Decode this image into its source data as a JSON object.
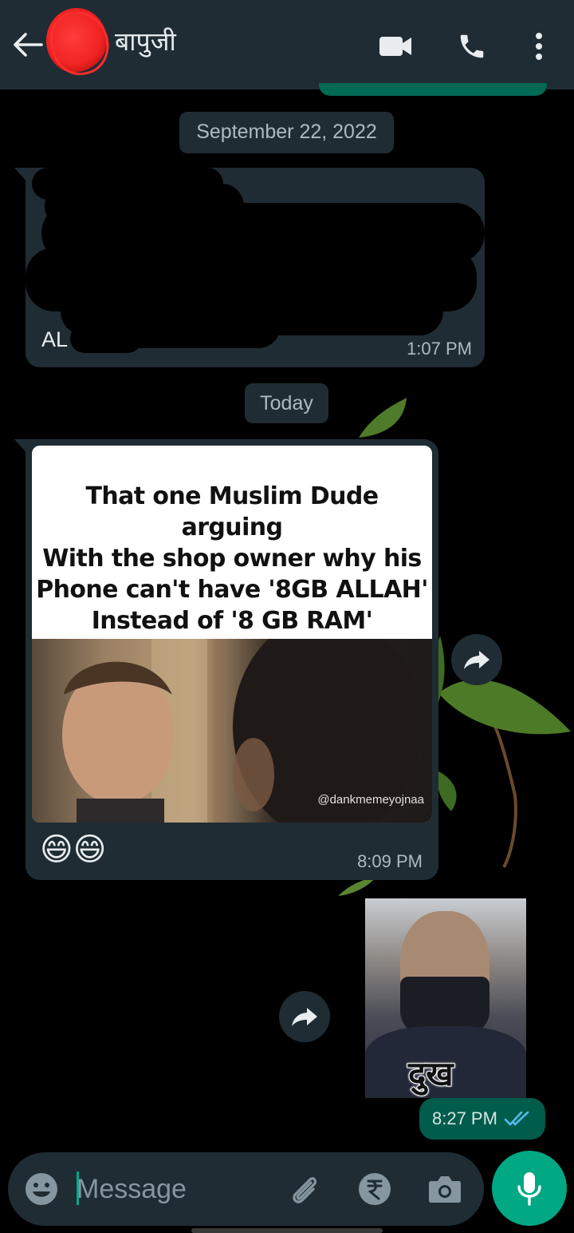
{
  "header": {
    "contact_name": "बापुजी",
    "icons": [
      "back-arrow-icon",
      "avatar",
      "video-call-icon",
      "phone-icon",
      "more-vert-icon"
    ]
  },
  "chat": {
    "date_separator_1": "September 22, 2022",
    "message_1": {
      "visible_text": "AL",
      "time": "1:07 PM",
      "redacted": true
    },
    "date_separator_2": "Today",
    "message_2": {
      "meme_caption_lines": [
        "That one Muslim Dude arguing",
        "With the shop owner why his",
        "Phone can't have '8GB ALLAH'",
        "Instead of '8 GB RAM'"
      ],
      "watermark": "@dankmemeyojnaa",
      "emoji_text": "😄😄",
      "time": "8:09 PM"
    },
    "message_3": {
      "sticker_text": "दुख",
      "time": "8:27 PM",
      "status_icon": "double-check-read-icon"
    }
  },
  "input": {
    "placeholder": "Message",
    "icons": [
      "emoji-icon",
      "attach-icon",
      "rupee-icon",
      "camera-icon",
      "mic-icon"
    ]
  },
  "colors": {
    "header_bg": "#1f2c34",
    "incoming_bubble": "#1f2c34",
    "outgoing_bubble": "#005c4b",
    "accent": "#00a884",
    "read_ticks": "#53bdeb"
  }
}
